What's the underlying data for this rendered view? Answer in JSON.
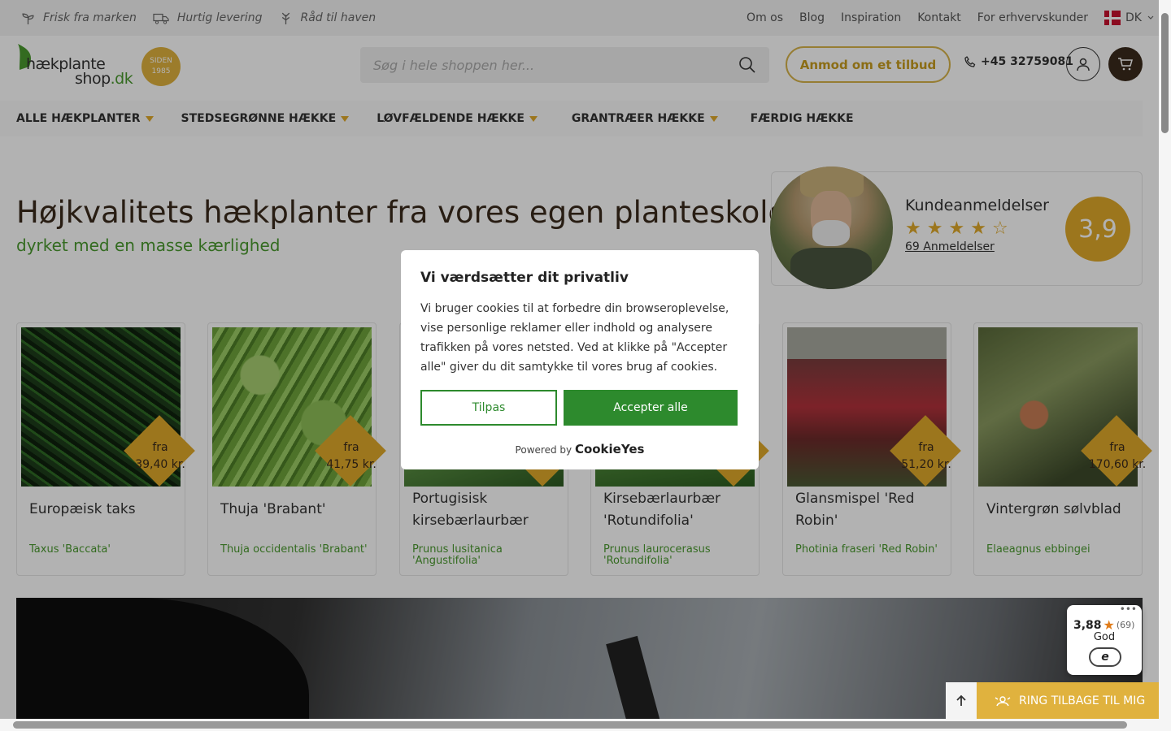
{
  "topbar": {
    "usps": [
      {
        "icon": "sprout-icon",
        "label": "Frisk fra marken"
      },
      {
        "icon": "truck-icon",
        "label": "Hurtig levering"
      },
      {
        "icon": "plant-icon",
        "label": "Råd til haven"
      }
    ],
    "links": [
      "Om os",
      "Blog",
      "Inspiration",
      "Kontakt",
      "For erhvervskunder"
    ],
    "language": "DK"
  },
  "header": {
    "logo_line1": "hækplante",
    "logo_line2": "shop",
    "logo_tld": ".dk",
    "since_label": "SIDEN",
    "since_year": "1985",
    "search_placeholder": "Søg i hele shoppen her...",
    "quote_button": "Anmod om et tilbud",
    "phone": "+45 32759081"
  },
  "nav": [
    {
      "label": "ALLE HÆKPLANTER",
      "has_dropdown": true
    },
    {
      "label": "STEDSEGRØNNE HÆKKE",
      "has_dropdown": true
    },
    {
      "label": "LØVFÆLDENDE HÆKKE",
      "has_dropdown": true
    },
    {
      "label": "GRANTRÆER HÆKKE",
      "has_dropdown": true
    },
    {
      "label": "FÆRDIG HÆKKE",
      "has_dropdown": false
    }
  ],
  "hero": {
    "title": "Højkvalitets hækplanter fra vores egen planteskole",
    "subtitle": "dyrket med en masse kærlighed"
  },
  "reviews": {
    "title": "Kundeanmeldelser",
    "count_label": "69 Anmeldelser",
    "rating": "3,9",
    "stars_filled": 4,
    "stars_total": 5
  },
  "products": [
    {
      "from": "fra",
      "price": "39,40 kr.",
      "name": "Europæisk taks",
      "latin": "Taxus 'Baccata'"
    },
    {
      "from": "fra",
      "price": "41,75 kr.",
      "name": "Thuja 'Brabant'",
      "latin": "Thuja occidentalis 'Brabant'"
    },
    {
      "from": "",
      "price": "",
      "name": "Portugisisk kirsebærlaurbær",
      "latin": "Prunus lusitanica 'Angustifolia'"
    },
    {
      "from": "",
      "price": "",
      "name": "Kirsebærlaurbær 'Rotundifolia'",
      "latin": "Prunus laurocerasus 'Rotundifolia'"
    },
    {
      "from": "fra",
      "price": "51,20 kr.",
      "name": "Glansmispel 'Red Robin'",
      "latin": "Photinia fraseri 'Red Robin'"
    },
    {
      "from": "fra",
      "price": "170,60 kr.",
      "name": "Vintergrøn sølvblad",
      "latin": "Elaeagnus ebbingei"
    }
  ],
  "cookie": {
    "title": "Vi værdsætter dit privatliv",
    "body": "Vi bruger cookies til at forbedre din browseroplevelse, vise personlige reklamer eller indhold og analysere trafikken på vores netsted. Ved at klikke på \"Accepter alle\" giver du dit samtykke til vores brug af cookies.",
    "customize": "Tilpas",
    "accept": "Accepter alle",
    "powered_by": "Powered by",
    "brand": "CookieYes"
  },
  "trustbadge": {
    "score": "3,88",
    "count": "(69)",
    "grade": "God",
    "mark": "e"
  },
  "callback_button": "RING TILBAGE TIL MIG",
  "colors": {
    "accent": "#e0a92a",
    "green": "#4a9a2e",
    "cookie_green": "#2d8a2d",
    "brown": "#3a2a1c"
  }
}
